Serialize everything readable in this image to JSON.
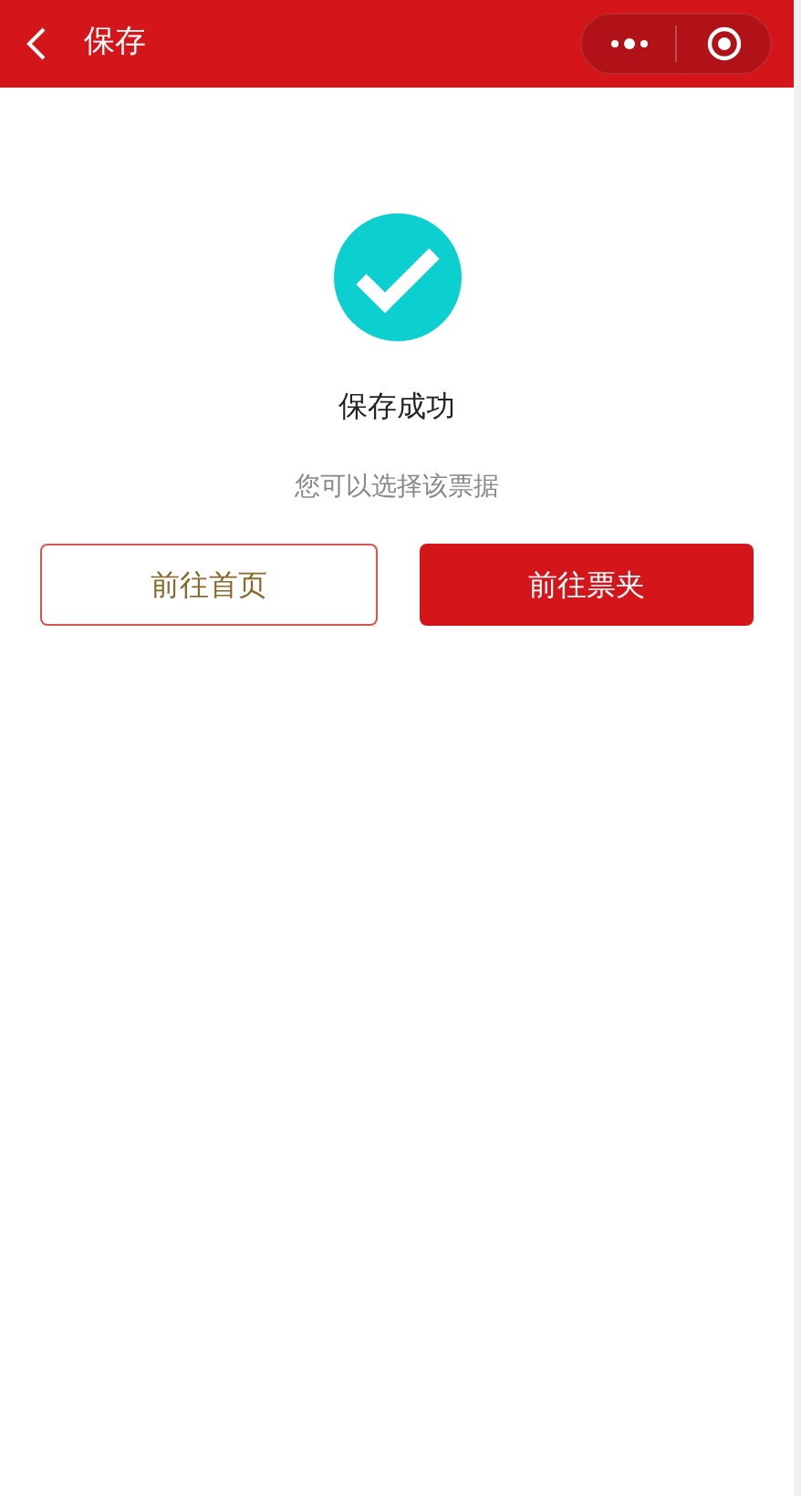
{
  "nav_bar": {
    "title": "保存"
  },
  "result": {
    "title": "保存成功",
    "message": "您可以选择该票据"
  },
  "buttons": [
    {
      "label": "前往首页",
      "kind": "outline"
    },
    {
      "label": "前往票夹",
      "kind": "primary"
    }
  ]
}
